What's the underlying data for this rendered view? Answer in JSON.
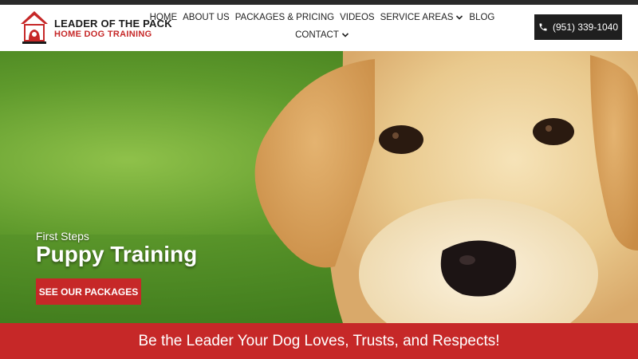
{
  "brand": {
    "name": "LEADER OF THE PACK",
    "subtitle": "HOME DOG TRAINING",
    "logo_icon": "doghouse-logo",
    "accent_color": "#c62828"
  },
  "nav": {
    "items": [
      {
        "label": "HOME"
      },
      {
        "label": "ABOUT US"
      },
      {
        "label": "PACKAGES & PRICING"
      },
      {
        "label": "VIDEOS"
      },
      {
        "label": "SERVICE AREAS",
        "has_dropdown": true
      },
      {
        "label": "BLOG"
      },
      {
        "label": "CONTACT",
        "has_dropdown": true
      }
    ]
  },
  "phone": {
    "label": "(951) 339-1040",
    "icon": "phone-icon"
  },
  "hero": {
    "pretitle": "First Steps",
    "title": "Puppy Training",
    "cta_label": "SEE OUR PACKAGES"
  },
  "banner": {
    "text": "Be the Leader Your Dog Loves, Trusts, and Respects!"
  }
}
